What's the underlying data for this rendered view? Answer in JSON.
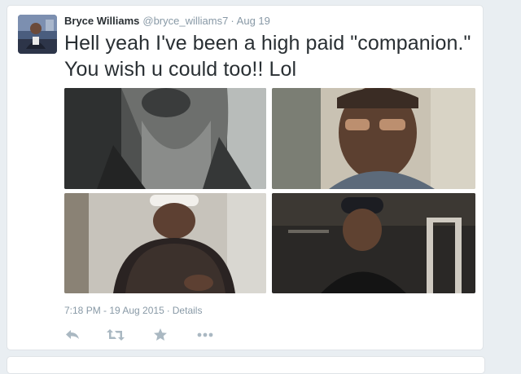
{
  "tweet": {
    "author_name": "Bryce Williams",
    "author_handle": "@bryce_williams7",
    "separator": "·",
    "date_short": "Aug 19",
    "text": "Hell yeah I've been a high paid \"companion.\" You wish u could too!! Lol",
    "timestamp": "7:18 PM - 19 Aug 2015",
    "meta_separator": "·",
    "details_label": "Details"
  },
  "actions": [
    "reply-icon",
    "retweet-icon",
    "favorite-icon",
    "more-icon"
  ],
  "colors": {
    "link": "#8899a6",
    "text": "#292f33",
    "icon": "#aab8c2"
  }
}
